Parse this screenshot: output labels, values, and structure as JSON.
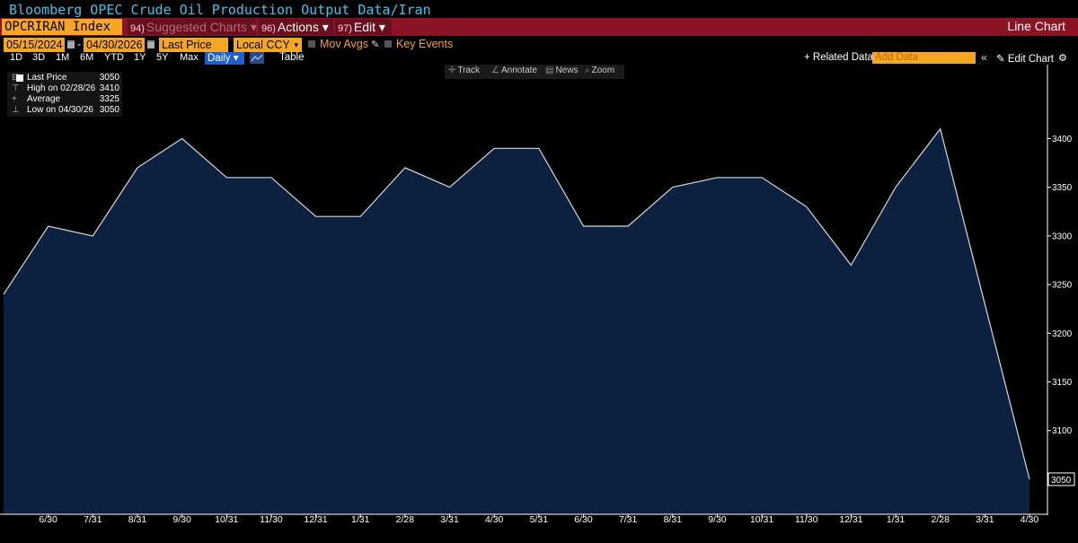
{
  "window": {
    "title": "Bloomberg OPEC Crude Oil Production Output Data/Iran"
  },
  "command_bar": {
    "ticker": "OPCRIRAN Index",
    "suggested_num": "94)",
    "suggested_label": "Suggested Charts",
    "actions_num": "96)",
    "actions_label": "Actions",
    "edit_num": "97)",
    "edit_label": "Edit",
    "chart_type": "Line Chart"
  },
  "params": {
    "start_date": "05/15/2024",
    "end_date": "04/30/2026",
    "field": "Last Price",
    "currency": "Local CCY",
    "mov_avgs": "Mov Avgs",
    "key_events": "Key Events"
  },
  "periods": [
    "1D",
    "3D",
    "1M",
    "6M",
    "YTD",
    "1Y",
    "5Y",
    "Max"
  ],
  "period_bar": {
    "frequency": "Daily",
    "table": "Table",
    "related_data": "+ Related Data",
    "add_data_placeholder": "Add Data",
    "collapse": "«",
    "edit_chart": "Edit Chart",
    "settings_icon": "gear-icon"
  },
  "tools": {
    "track": "Track",
    "annotate": "Annotate",
    "news": "News",
    "zoom": "Zoom"
  },
  "legend": {
    "last_label": "Last Price",
    "last_value": "3050",
    "high_label": "High on 02/28/26",
    "high_value": "3410",
    "avg_label": "Average",
    "avg_value": "3325",
    "low_label": "Low on 04/30/26",
    "low_value": "3050"
  },
  "chart_data": {
    "type": "area",
    "series": [
      {
        "name": "Last Price",
        "x": [
          "05/31/24",
          "06/30/24",
          "07/31/24",
          "08/31/24",
          "09/30/24",
          "10/31/24",
          "11/30/24",
          "12/31/24",
          "01/31/25",
          "02/28/25",
          "03/31/25",
          "04/30/25",
          "05/31/25",
          "06/30/25",
          "07/31/25",
          "08/31/25",
          "09/30/25",
          "10/31/25",
          "11/30/25",
          "12/31/25",
          "01/31/26",
          "02/28/26",
          "03/31/26",
          "04/30/26"
        ],
        "values": [
          3240,
          3310,
          3300,
          3370,
          3400,
          3360,
          3360,
          3320,
          3320,
          3370,
          3350,
          3390,
          3390,
          3310,
          3310,
          3350,
          3360,
          3360,
          3330,
          3270,
          3350,
          3410,
          3230,
          3050
        ]
      }
    ],
    "x_tick_labels": [
      "6/30",
      "7/31",
      "8/31",
      "9/30",
      "10/31",
      "11/30",
      "12/31",
      "1/31",
      "2/28",
      "3/31",
      "4/30",
      "5/31",
      "6/30",
      "7/31",
      "8/31",
      "9/30",
      "10/31",
      "11/30",
      "12/31",
      "1/31",
      "2/28",
      "3/31",
      "4/30"
    ],
    "y_ticks": [
      3100,
      3150,
      3200,
      3250,
      3300,
      3350,
      3400
    ],
    "ylim": [
      3014,
      3476
    ],
    "last_value_label": "3050",
    "colors": {
      "fill": "#0c2140",
      "line": "#d8d8d8",
      "background": "#000000",
      "axis": "#ffffff"
    },
    "grid": false,
    "legend_position": "top-left"
  }
}
